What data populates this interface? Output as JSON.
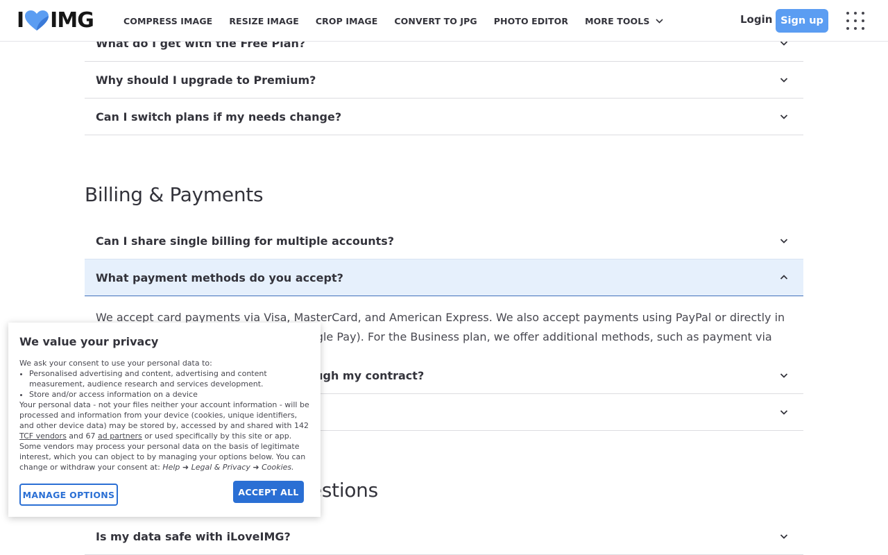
{
  "header": {
    "logo_left": "I",
    "logo_right": "IMG",
    "nav": [
      "COMPRESS IMAGE",
      "RESIZE IMAGE",
      "CROP IMAGE",
      "CONVERT TO JPG",
      "PHOTO EDITOR",
      "MORE TOOLS"
    ],
    "login": "Login",
    "signup": "Sign up"
  },
  "faq_top": [
    "What do I get with the Free Plan?",
    "Why should I upgrade to Premium?",
    "Can I switch plans if my needs change?"
  ],
  "billing": {
    "title": "Billing & Payments",
    "q1": "Can I share single billing for multiple accounts?",
    "q2": "What payment methods do you accept?",
    "answer": "We accept card payments via Visa, MasterCard, and American Express. We also accept payments using PayPal or directly in the mobile app (using Apple Pay or Google Pay). For the Business plan, we offer additional methods, such as payment via Bank transfer.",
    "q3": "Can I change my plan partway through my contract?",
    "q4": ""
  },
  "security": {
    "title": "Security & Technical Questions",
    "q1": "Is my data safe with iLoveIMG?"
  },
  "cookie": {
    "title": "We value your privacy",
    "intro": "We ask your consent to use your personal data to:",
    "bullets": [
      "Personalised advertising and content, advertising and content measurement, audience research and services development.",
      "Store and/or access information on a device"
    ],
    "body_1": "Your personal data - not your files neither your account information - will be processed and information from your device (cookies, unique identifiers, and other device data) may be stored by, accessed by and shared with 142 ",
    "tcf_link": "TCF vendors",
    "body_2": " and 67 ",
    "ad_link": "ad partners",
    "body_3": " or used specifically by this site or app. Some vendors may process your personal data on the basis of legitimate interest, which you can object to by managing your options below. You can change or withdraw your consent at: ",
    "path": "Help ➜ Legal & Privacy ➜ Cookies.",
    "manage": "MANAGE OPTIONS",
    "accept": "ACCEPT ALL"
  },
  "colors": {
    "brand_blue": "#5b9df2",
    "consent_blue": "#2a6fd4",
    "open_row_bg": "#e6f0fc"
  }
}
